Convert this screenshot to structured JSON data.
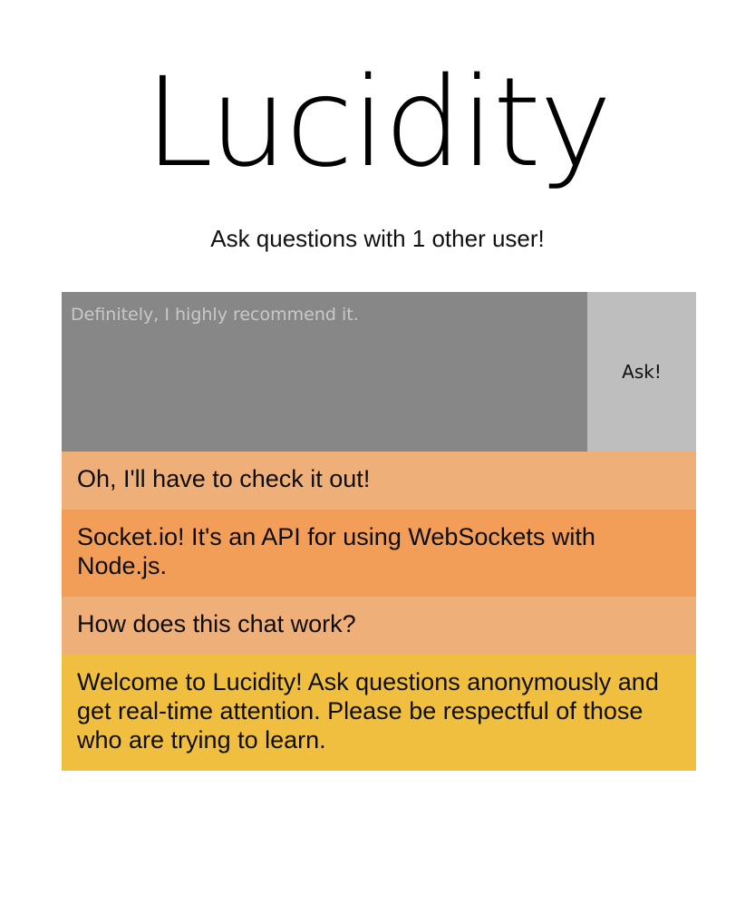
{
  "app": {
    "title": "Lucidity",
    "subtitle": "Ask questions with 1 other user!"
  },
  "composer": {
    "input_value": "",
    "input_placeholder": "Definitely, I highly recommend it.",
    "ask_label": "Ask!"
  },
  "messages": [
    {
      "text": "Oh, I'll have to check it out!",
      "color": "#efaf79"
    },
    {
      "text": "Socket.io! It's an API for using WebSockets with Node.js.",
      "color": "#f29e59"
    },
    {
      "text": "How does this chat work?",
      "color": "#efaf79"
    },
    {
      "text": "Welcome to Lucidity! Ask questions anonymously and get real-time attention. Please be respectful of those who are trying to learn.",
      "color": "#f0bf3f"
    }
  ],
  "colors": {
    "input_background": "#878787",
    "button_background": "#bebebe"
  }
}
